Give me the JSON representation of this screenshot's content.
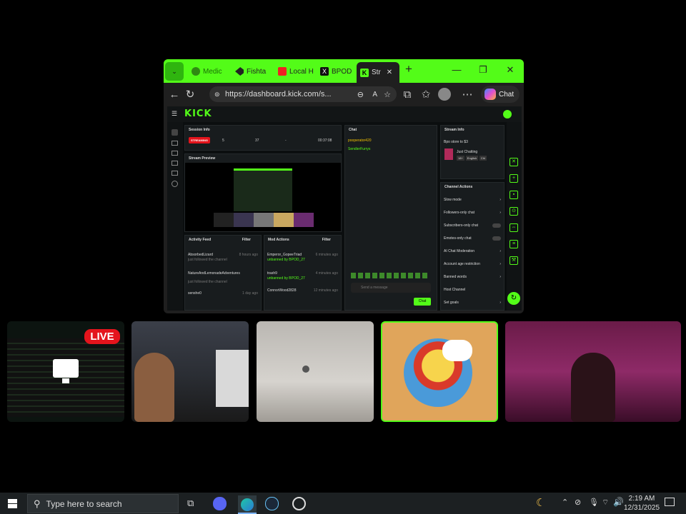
{
  "browser": {
    "tabs": [
      {
        "label": "Medic",
        "faded": true
      },
      {
        "label": "Fishta",
        "faded": false
      },
      {
        "label": "Local H",
        "faded": false
      },
      {
        "label": "BPOD",
        "faded": false
      },
      {
        "label": "Str",
        "faded": false,
        "active": true
      }
    ],
    "url": "https://dashboard.kick.com/s...",
    "copilot_label": "Chat",
    "colors": {
      "accent": "#53fc18"
    }
  },
  "kick": {
    "logo": "KICK",
    "session_info": {
      "title": "Session Info",
      "status": "STREAMING",
      "stats": [
        "5",
        "37",
        "-",
        "00:37:08"
      ]
    },
    "stream_preview": {
      "title": "Stream Preview"
    },
    "activity_feed": {
      "title": "Activity Feed",
      "filter": "Filter",
      "items": [
        {
          "name": "AbsorbedLizard",
          "sub": "just followed the channel",
          "time": "8 hours ago"
        },
        {
          "name": "NatureAndLemonadeAdventures",
          "sub": "just followed the channel",
          "time": "8 hours ago"
        },
        {
          "name": "senshe0",
          "sub": "",
          "time": "1 day ago"
        }
      ]
    },
    "mod_actions": {
      "title": "Mod Actions",
      "filter": "Filter",
      "items": [
        {
          "name": "Emperor_GopeeTriad",
          "sub": "unbanned by BPOD_27",
          "time": "6 minutes ago"
        },
        {
          "name": "trash9",
          "sub": "unbanned by BPOD_27",
          "time": "4 minutes ago"
        },
        {
          "name": "ConnorWood2828",
          "sub": "",
          "time": "12 minutes ago"
        }
      ]
    },
    "chat": {
      "title": "Chat",
      "messages": [
        "pooperator420",
        "SendierFurrys"
      ],
      "placeholder": "Send a message",
      "send": "Chat"
    },
    "stream_info": {
      "title": "Stream Info",
      "stream_title": "Bpo store to $3",
      "category": "Just Chatting",
      "tags": [
        "18+",
        "English",
        "Chl"
      ]
    },
    "channel_actions": {
      "title": "Channel Actions",
      "items": [
        "Slow mode",
        "Followers-only chat",
        "Subscribers-only chat",
        "Emotes-only chat",
        "AI Chat Moderation",
        "Account age restriction",
        "Banned words",
        "Host Channel",
        "Set goals"
      ]
    }
  },
  "tiles": {
    "live_badge": "LIVE"
  },
  "taskbar": {
    "search_placeholder": "Type here to search",
    "time": "2:19 AM",
    "date": "12/31/2025"
  }
}
